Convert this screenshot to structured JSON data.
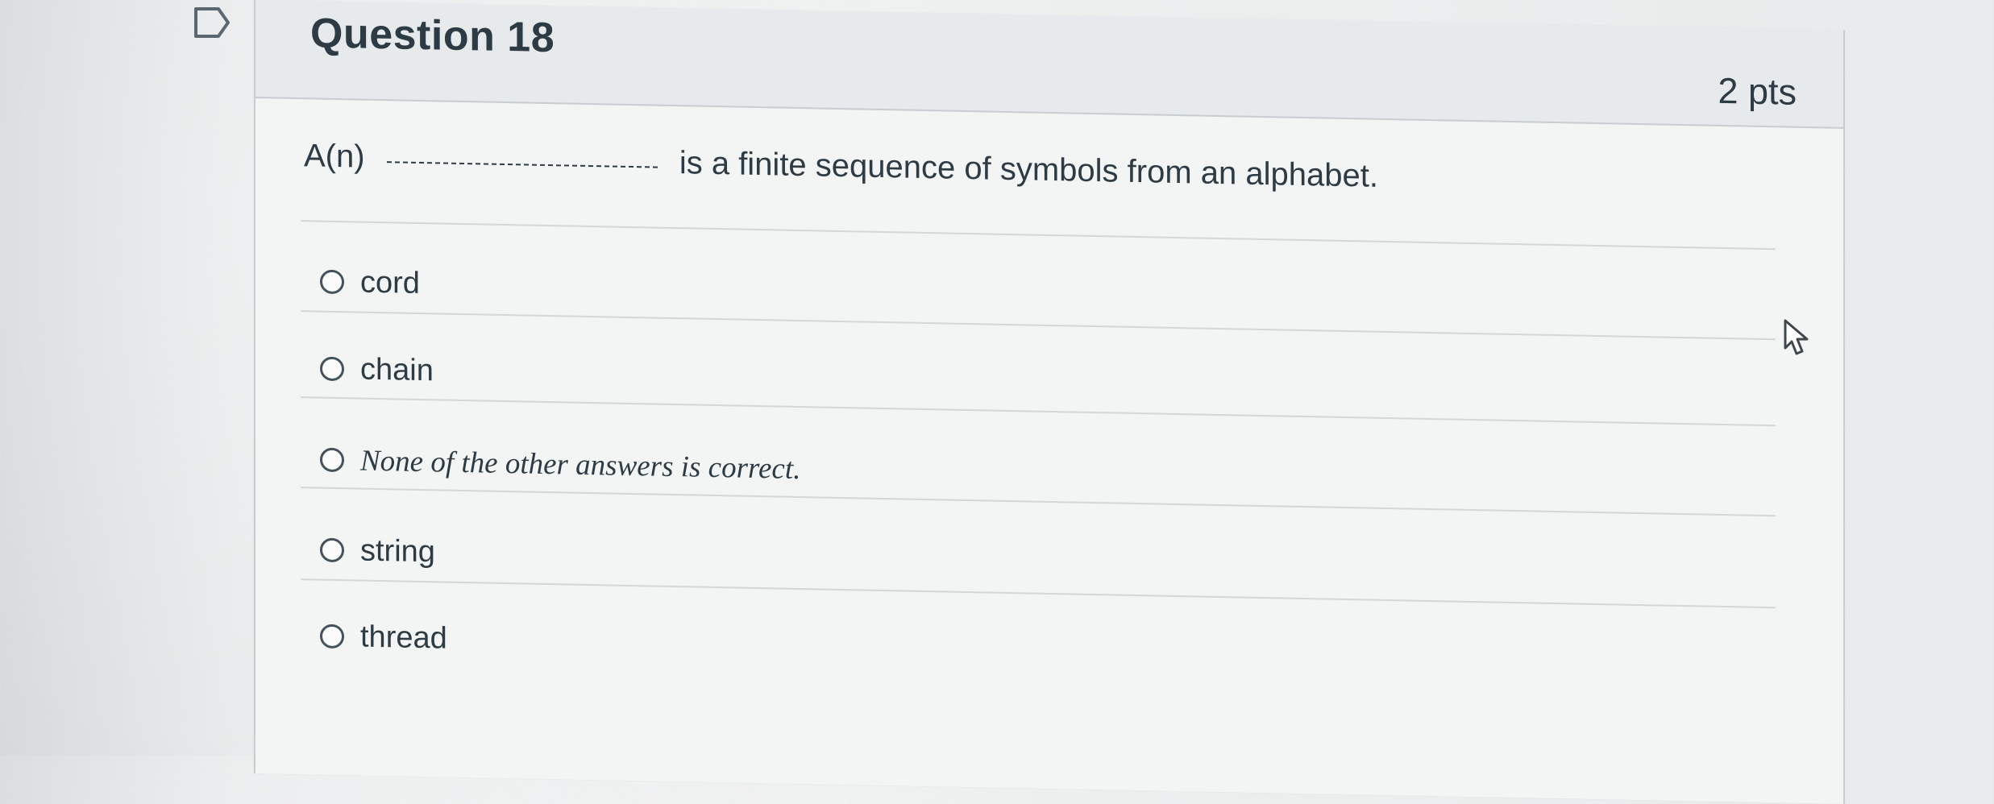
{
  "question": {
    "title": "Question 18",
    "points": "2 pts",
    "text_prefix": "A(n)",
    "text_suffix": "is a finite sequence of symbols from an alphabet."
  },
  "answers": [
    {
      "label": "cord"
    },
    {
      "label": "chain"
    },
    {
      "label": "None of the other answers is correct."
    },
    {
      "label": "string"
    },
    {
      "label": "thread"
    }
  ],
  "icons": {
    "bookmark": "bookmark-flag-icon",
    "cursor": "mouse-pointer-icon"
  },
  "colors": {
    "text": "#2d3b45",
    "header_background": "#e7eaec",
    "border": "#c7cdd1"
  }
}
